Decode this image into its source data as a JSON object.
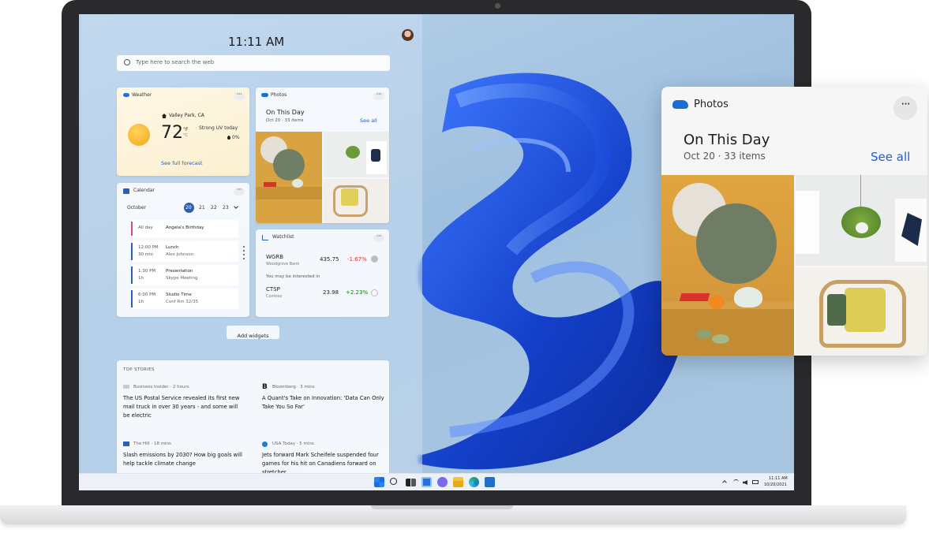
{
  "board": {
    "clock": "11:11 AM",
    "search_placeholder": "Type here to search the web",
    "add_widgets": "Add widgets"
  },
  "weather": {
    "title": "Weather",
    "location": "Valley Park, CA",
    "temp": "72",
    "unit_f": "°F",
    "unit_c": "°C",
    "condition": "Strong UV today",
    "precip": "0%",
    "forecast_link": "See full forecast"
  },
  "photos_small": {
    "title": "Photos",
    "heading": "On This Day",
    "sub": "Oct 20 · 33 items",
    "see_all": "See all"
  },
  "calendar": {
    "title": "Calendar",
    "month": "October",
    "days": [
      "20",
      "21",
      "22",
      "23"
    ],
    "events": [
      {
        "time": "All day",
        "duration": "",
        "title": "Angela's Birthday",
        "detail": "",
        "color": "#e0457b"
      },
      {
        "time": "12:00 PM",
        "duration": "30 min",
        "title": "Lunch",
        "detail": "Alex Johnson",
        "color": "#2e5fb8"
      },
      {
        "time": "1:30 PM",
        "duration": "1h",
        "title": "Presentation",
        "detail": "Skype Meeting",
        "color": "#2e5fb8"
      },
      {
        "time": "6:00 PM",
        "duration": "1h",
        "title": "Studio Time",
        "detail": "Conf Rm 32/35",
        "color": "#2e5fb8"
      }
    ]
  },
  "watchlist": {
    "title": "Watchlist",
    "stocks": [
      {
        "symbol": "WGRB",
        "name": "Woodgrove Bank",
        "price": "435.75",
        "change": "-1.67%",
        "color": "#d13438"
      },
      {
        "symbol": "CTSP",
        "name": "Contoso",
        "price": "23.98",
        "change": "+2.23%",
        "color": "#107c10"
      }
    ],
    "interest": "You may be interested in"
  },
  "stories": {
    "heading": "TOP STORIES",
    "items": [
      {
        "source": "Business Insider · 2 hours",
        "headline": "The US Postal Service revealed its first new mail truck in over 30 years - and some will be electric"
      },
      {
        "source": "Bloomberg · 3 mins",
        "headline": "A Quant's Take on Innovation: 'Data Can Only Take You So Far'"
      },
      {
        "source": "The Hill · 18 mins",
        "headline": "Slash emissions by 2030? How big goals will help tackle climate change"
      },
      {
        "source": "USA Today · 5 mins",
        "headline": "Jets forward Mark Scheifele suspended four games for his hit on Canadiens forward on stretcher"
      }
    ]
  },
  "taskbar": {
    "time": "11:11 AM",
    "date": "10/20/2021"
  },
  "photos_popup": {
    "title": "Photos",
    "heading": "On This Day",
    "sub": "Oct 20 · 33 items",
    "see_all": "See all"
  },
  "colors": {
    "accent": "#1a5fd6",
    "wallpaper_blue": "#1f4fd8",
    "negative": "#d13438",
    "positive": "#107c10"
  }
}
